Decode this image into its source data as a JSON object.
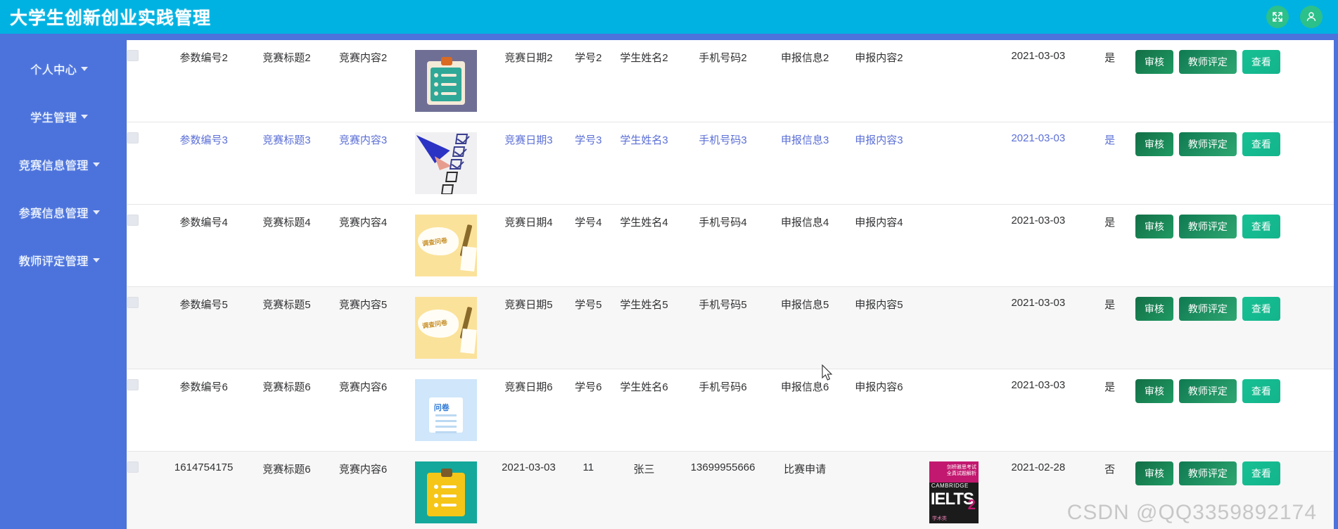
{
  "header": {
    "title": "大学生创新创业实践管理",
    "bg_color": "#00b2e2",
    "actions": [
      {
        "name": "fullscreen-icon",
        "label": "全屏"
      },
      {
        "name": "user-icon",
        "label": "用户"
      }
    ]
  },
  "sidebar": {
    "bg_color": "#4c72dc",
    "items": [
      {
        "label": "个人中心"
      },
      {
        "label": "学生管理"
      },
      {
        "label": "竞赛信息管理"
      },
      {
        "label": "参赛信息管理"
      },
      {
        "label": "教师评定管理"
      }
    ]
  },
  "buttons": {
    "review": "审核",
    "evaluate": "教师评定",
    "view": "查看",
    "review_color": "#1f9a63",
    "evaluate_color": "#2ea772",
    "view_color": "#16c093"
  },
  "table": {
    "rows": [
      {
        "num": "参数编号2",
        "title": "竞赛标题2",
        "content": "竞赛内容2",
        "image": "clipboard-purple-thumbnail",
        "date": "竞赛日期2",
        "student_id": "学号2",
        "student_name": "学生姓名2",
        "phone": "手机号码2",
        "declare_info": "申报信息2",
        "declare_content": "申报内容2",
        "image2": "",
        "date2": "2021-03-03",
        "flag": "是",
        "stripe": false,
        "hovered": false
      },
      {
        "num": "参数编号3",
        "title": "竞赛标题3",
        "content": "竞赛内容3",
        "image": "pen-checklist-thumbnail",
        "date": "竞赛日期3",
        "student_id": "学号3",
        "student_name": "学生姓名3",
        "phone": "手机号码3",
        "declare_info": "申报信息3",
        "declare_content": "申报内容3",
        "image2": "",
        "date2": "2021-03-03",
        "flag": "是",
        "stripe": false,
        "hovered": true
      },
      {
        "num": "参数编号4",
        "title": "竞赛标题4",
        "content": "竞赛内容4",
        "image": "survey-yellow-thumbnail",
        "date": "竞赛日期4",
        "student_id": "学号4",
        "student_name": "学生姓名4",
        "phone": "手机号码4",
        "declare_info": "申报信息4",
        "declare_content": "申报内容4",
        "image2": "",
        "date2": "2021-03-03",
        "flag": "是",
        "stripe": false,
        "hovered": false
      },
      {
        "num": "参数编号5",
        "title": "竞赛标题5",
        "content": "竞赛内容5",
        "image": "survey-yellow-thumbnail",
        "date": "竞赛日期5",
        "student_id": "学号5",
        "student_name": "学生姓名5",
        "phone": "手机号码5",
        "declare_info": "申报信息5",
        "declare_content": "申报内容5",
        "image2": "",
        "date2": "2021-03-03",
        "flag": "是",
        "stripe": true,
        "hovered": false
      },
      {
        "num": "参数编号6",
        "title": "竞赛标题6",
        "content": "竞赛内容6",
        "image": "questionnaire-blue-thumbnail",
        "date": "竞赛日期6",
        "student_id": "学号6",
        "student_name": "学生姓名6",
        "phone": "手机号码6",
        "declare_info": "申报信息6",
        "declare_content": "申报内容6",
        "image2": "",
        "date2": "2021-03-03",
        "flag": "是",
        "stripe": false,
        "hovered": false
      },
      {
        "num": "1614754175",
        "title": "竞赛标题6",
        "content": "竞赛内容6",
        "image": "clipboard-teal-thumbnail",
        "date": "2021-03-03",
        "student_id": "11",
        "student_name": "张三",
        "phone": "13699955666",
        "declare_info": "比赛申请",
        "declare_content": "",
        "image2": "ielts-book-thumbnail",
        "date2": "2021-02-28",
        "flag": "否",
        "stripe": true,
        "hovered": false
      }
    ]
  },
  "watermark": "CSDN @QQ3359892174"
}
